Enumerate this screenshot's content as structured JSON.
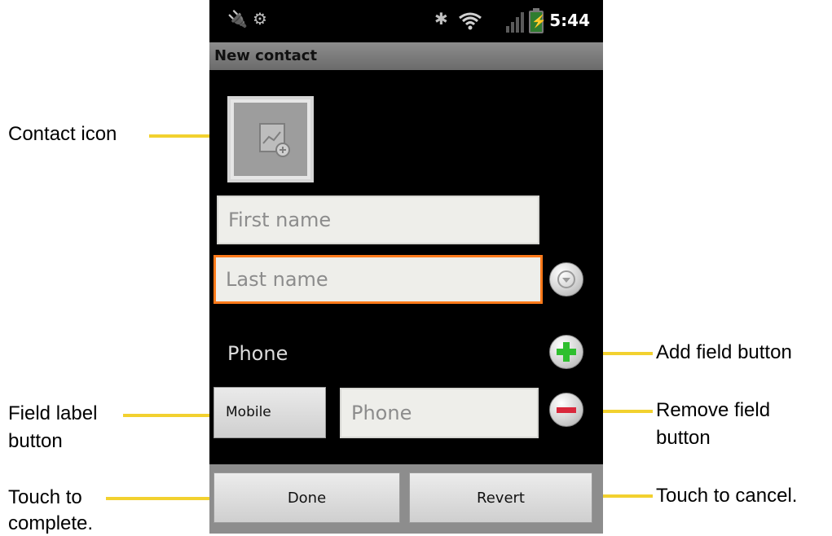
{
  "status_bar": {
    "time": "5:44",
    "icons": [
      "usb-icon",
      "android-icon",
      "bluetooth-icon",
      "wifi-icon",
      "signal-icon",
      "battery-icon"
    ]
  },
  "screen": {
    "title": "New contact",
    "first_name_placeholder": "First name",
    "last_name_placeholder": "Last name",
    "phone_section_label": "Phone",
    "field_label_button": "Mobile",
    "phone_placeholder": "Phone",
    "done_button": "Done",
    "revert_button": "Revert"
  },
  "callouts": {
    "contact_icon": "Contact icon",
    "add_field": "Add field button",
    "field_label_line1": "Field label",
    "field_label_line2": "button",
    "remove_field_line1": "Remove field",
    "remove_field_line2": "button",
    "done_line1": "Touch to",
    "done_line2": "complete.",
    "cancel": "Touch to cancel."
  },
  "colors": {
    "accent_focus": "#ff7a1a",
    "callout_line": "#f2d12f",
    "add_button": "#2fbf2f",
    "remove_button": "#d9283c"
  }
}
